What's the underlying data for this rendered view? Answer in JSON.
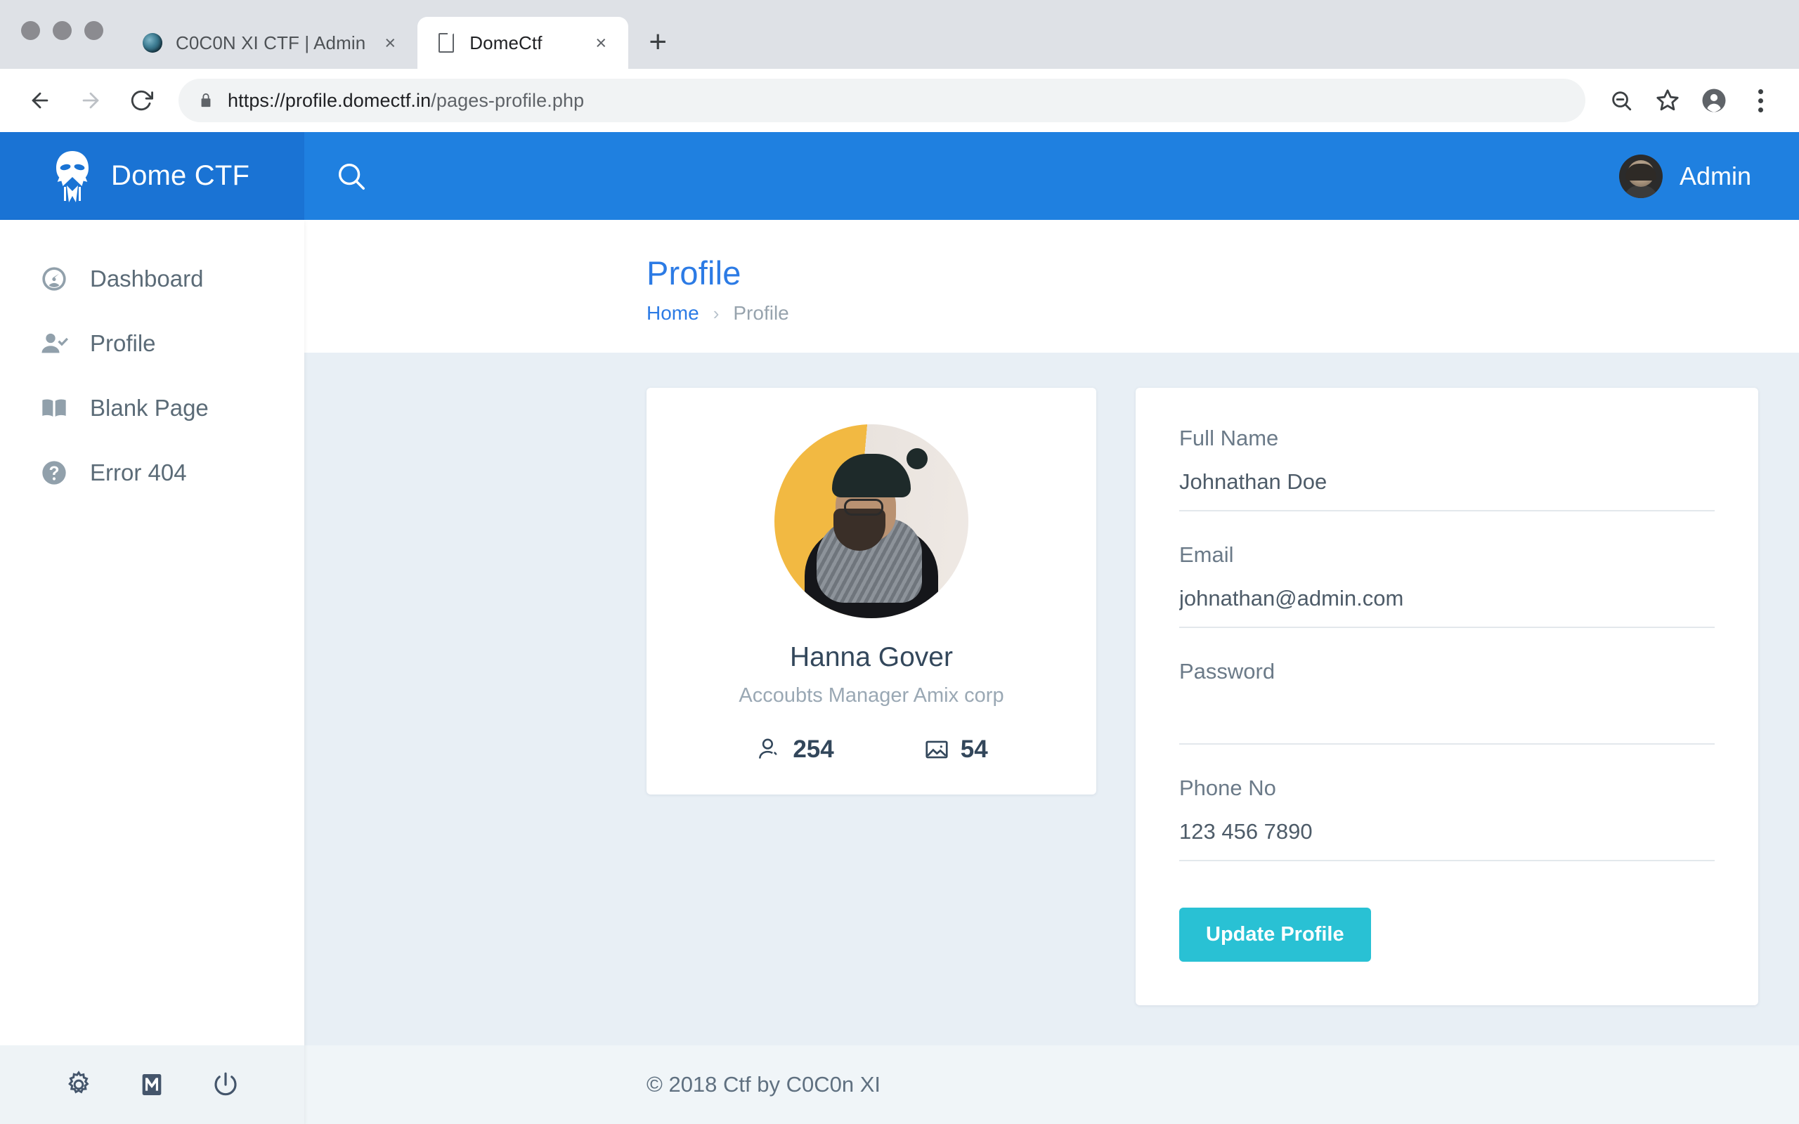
{
  "browser": {
    "tabs": [
      {
        "title": "C0C0N XI CTF | Admin",
        "favicon": "globe-icon",
        "active": false,
        "close_label": "×"
      },
      {
        "title": "DomeCtf",
        "favicon": "document-icon",
        "active": true,
        "close_label": "×"
      }
    ],
    "new_tab_label": "+",
    "url_secure": "https://profile.domectf.in",
    "url_path": "/pages-profile.php",
    "url_full": "https://profile.domectf.in/pages-profile.php",
    "toolbar_icons": [
      "back-icon",
      "forward-icon",
      "reload-icon",
      "lock-icon",
      "zoom-out-icon",
      "bookmark-star-icon",
      "browser-profile-icon",
      "kebab-menu-icon"
    ]
  },
  "app": {
    "brand": {
      "name": "Dome CTF",
      "logo": "ctf-skull-logo"
    },
    "topbar": {
      "search_icon": "search-icon",
      "user_name": "Admin",
      "avatar": "user-avatar"
    },
    "sidebar": {
      "items": [
        {
          "label": "Dashboard",
          "icon": "gauge-icon"
        },
        {
          "label": "Profile",
          "icon": "person-check-icon"
        },
        {
          "label": "Blank Page",
          "icon": "book-icon"
        },
        {
          "label": "Error 404",
          "icon": "question-circle-icon"
        }
      ],
      "footer_icons": [
        "gear-icon",
        "mail-icon",
        "power-icon"
      ]
    },
    "page": {
      "title": "Profile",
      "breadcrumb": {
        "home": "Home",
        "separator": "›",
        "current": "Profile"
      }
    },
    "profile_card": {
      "photo": "profile-photo",
      "name": "Hanna Gover",
      "role": "Accoubts Manager Amix corp",
      "stats": [
        {
          "icon": "followers-icon",
          "value": "254"
        },
        {
          "icon": "photos-icon",
          "value": "54"
        }
      ]
    },
    "form": {
      "fields": [
        {
          "label": "Full Name",
          "value": "Johnathan Doe",
          "placeholder": "",
          "type": "text"
        },
        {
          "label": "Email",
          "value": "johnathan@admin.com",
          "placeholder": "",
          "type": "text"
        },
        {
          "label": "Password",
          "value": "",
          "placeholder": "",
          "type": "password"
        },
        {
          "label": "Phone No",
          "value": "123 456 7890",
          "placeholder": "",
          "type": "text"
        }
      ],
      "submit_label": "Update Profile"
    },
    "footer": {
      "text": "© 2018 Ctf by C0C0n XI"
    },
    "colors": {
      "brand_blue": "#1a73d4",
      "topbar_blue": "#1f80e0",
      "accent_link": "#2c7be5",
      "button_cyan": "#29c1d4",
      "content_bg": "#e8eff5"
    }
  }
}
